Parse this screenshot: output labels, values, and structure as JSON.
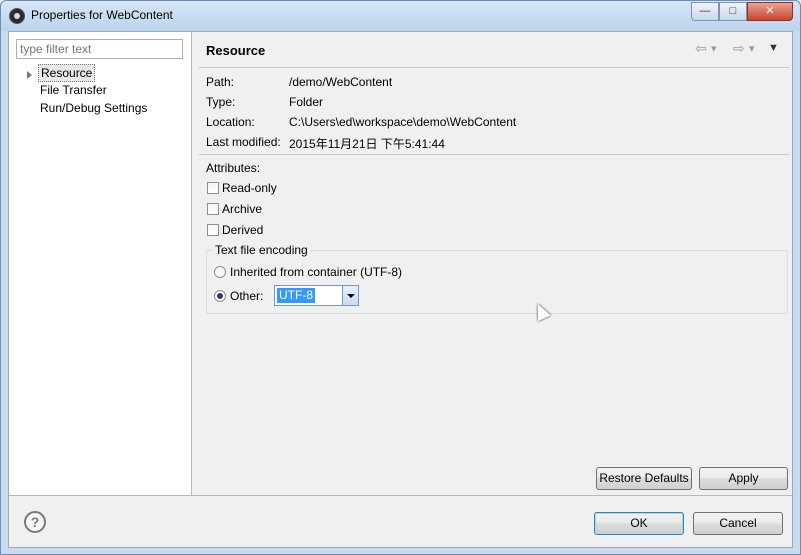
{
  "window": {
    "title": "Properties for WebContent",
    "minimize_glyph": "—",
    "maximize_glyph": "□",
    "close_glyph": "✕"
  },
  "sidebar": {
    "filter_placeholder": "type filter text",
    "items": [
      {
        "label": "Resource",
        "selected": true,
        "expandable": true
      },
      {
        "label": "File Transfer"
      },
      {
        "label": "Run/Debug Settings"
      }
    ]
  },
  "page": {
    "heading": "Resource",
    "nav_back_glyph": "⇦",
    "nav_forward_glyph": "⇨",
    "nav_dropdown_glyph": "▾",
    "menu_glyph": "▼",
    "properties": [
      {
        "label": "Path:",
        "value": "/demo/WebContent"
      },
      {
        "label": "Type:",
        "value": "Folder"
      },
      {
        "label": "Location:",
        "value": "C:\\Users\\ed\\workspace\\demo\\WebContent"
      },
      {
        "label": "Last modified:",
        "value": "2015年11月21日 下午5:41:44"
      }
    ],
    "attributes_label": "Attributes:",
    "attributes": [
      {
        "label": "Read-only",
        "checked": false
      },
      {
        "label": "Archive",
        "checked": false
      },
      {
        "label": "Derived",
        "checked": false
      }
    ],
    "encoding": {
      "group_title": "Text file encoding",
      "inherited_label": "Inherited from container (UTF-8)",
      "other_label": "Other:",
      "selected_option": "other",
      "other_value": "UTF-8"
    },
    "restore_defaults_label": "Restore Defaults",
    "apply_label": "Apply"
  },
  "footer": {
    "help_glyph": "?",
    "ok_label": "OK",
    "cancel_label": "Cancel"
  },
  "colors": {
    "selection": "#3399ff",
    "title_bar": "#c9dcef",
    "close_button": "#c9452b"
  }
}
